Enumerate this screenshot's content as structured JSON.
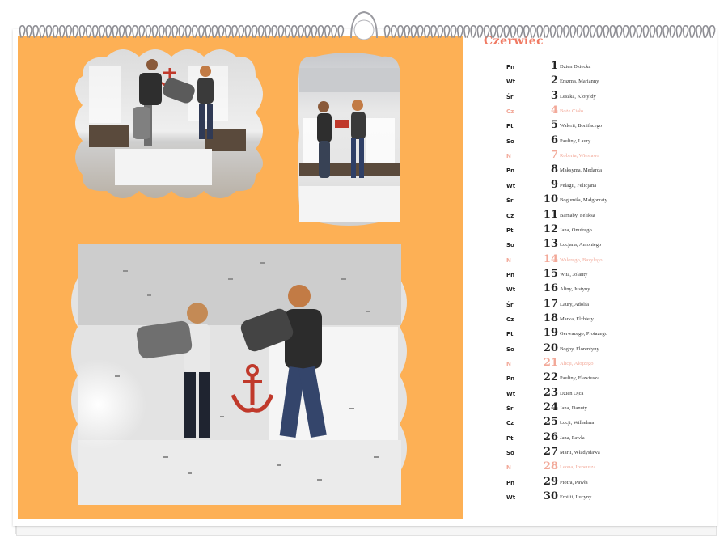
{
  "calendar": {
    "month": "Czerwiec",
    "days": [
      {
        "dow": "Pn",
        "num": "1",
        "names": "Dzien Dziecka",
        "sunday": false
      },
      {
        "dow": "Wt",
        "num": "2",
        "names": "Erazma, Marianny",
        "sunday": false
      },
      {
        "dow": "Śr",
        "num": "3",
        "names": "Leszka, Klotyldy",
        "sunday": false
      },
      {
        "dow": "Cz",
        "num": "4",
        "names": "Boże Ciało",
        "sunday": true
      },
      {
        "dow": "Pt",
        "num": "5",
        "names": "Walerii, Bonifacego",
        "sunday": false
      },
      {
        "dow": "So",
        "num": "6",
        "names": "Pauliny, Laury",
        "sunday": false
      },
      {
        "dow": "N",
        "num": "7",
        "names": "Roberta, Wiesława",
        "sunday": true
      },
      {
        "dow": "Pn",
        "num": "8",
        "names": "Maksyma, Medarda",
        "sunday": false
      },
      {
        "dow": "Wt",
        "num": "9",
        "names": "Pelagii, Felicjana",
        "sunday": false
      },
      {
        "dow": "Śr",
        "num": "10",
        "names": "Bogumiła, Małgorzaty",
        "sunday": false
      },
      {
        "dow": "Cz",
        "num": "11",
        "names": "Barnaby, Feliksa",
        "sunday": false
      },
      {
        "dow": "Pt",
        "num": "12",
        "names": "Jana, Onufrego",
        "sunday": false
      },
      {
        "dow": "So",
        "num": "13",
        "names": "Łucjana, Antoniego",
        "sunday": false
      },
      {
        "dow": "N",
        "num": "14",
        "names": "Walerego, Bazylego",
        "sunday": true
      },
      {
        "dow": "Pn",
        "num": "15",
        "names": "Wita, Jolanty",
        "sunday": false
      },
      {
        "dow": "Wt",
        "num": "16",
        "names": "Aliny, Justyny",
        "sunday": false
      },
      {
        "dow": "Śr",
        "num": "17",
        "names": "Laury, Adolfa",
        "sunday": false
      },
      {
        "dow": "Cz",
        "num": "18",
        "names": "Marka, Elżbiety",
        "sunday": false
      },
      {
        "dow": "Pt",
        "num": "19",
        "names": "Gerwazego, Protazego",
        "sunday": false
      },
      {
        "dow": "So",
        "num": "20",
        "names": "Bogny, Florentyny",
        "sunday": false
      },
      {
        "dow": "N",
        "num": "21",
        "names": "Alicji, Alojzego",
        "sunday": true
      },
      {
        "dow": "Pn",
        "num": "22",
        "names": "Pauliny, Flawiusza",
        "sunday": false
      },
      {
        "dow": "Wt",
        "num": "23",
        "names": "Dzien Ojca",
        "sunday": false
      },
      {
        "dow": "Śr",
        "num": "24",
        "names": "Jana, Danuty",
        "sunday": false
      },
      {
        "dow": "Cz",
        "num": "25",
        "names": "Łucji, Wilhelma",
        "sunday": false
      },
      {
        "dow": "Pt",
        "num": "26",
        "names": "Jana, Pawła",
        "sunday": false
      },
      {
        "dow": "So",
        "num": "27",
        "names": "Marii, Władysława",
        "sunday": false
      },
      {
        "dow": "N",
        "num": "28",
        "names": "Leona, Ireneusza",
        "sunday": true
      },
      {
        "dow": "Pn",
        "num": "29",
        "names": "Piotra, Pawła",
        "sunday": false
      },
      {
        "dow": "Wt",
        "num": "30",
        "names": "Emilii, Lucyny",
        "sunday": false
      }
    ]
  },
  "colors": {
    "photo_panel": "#fdb055",
    "month_title": "#f07a63",
    "sunday_text": "#f2a898",
    "weekday_text": "#222222"
  },
  "icons": [
    "spiral-binding-icon",
    "hanger-icon",
    "anchor-icon"
  ]
}
